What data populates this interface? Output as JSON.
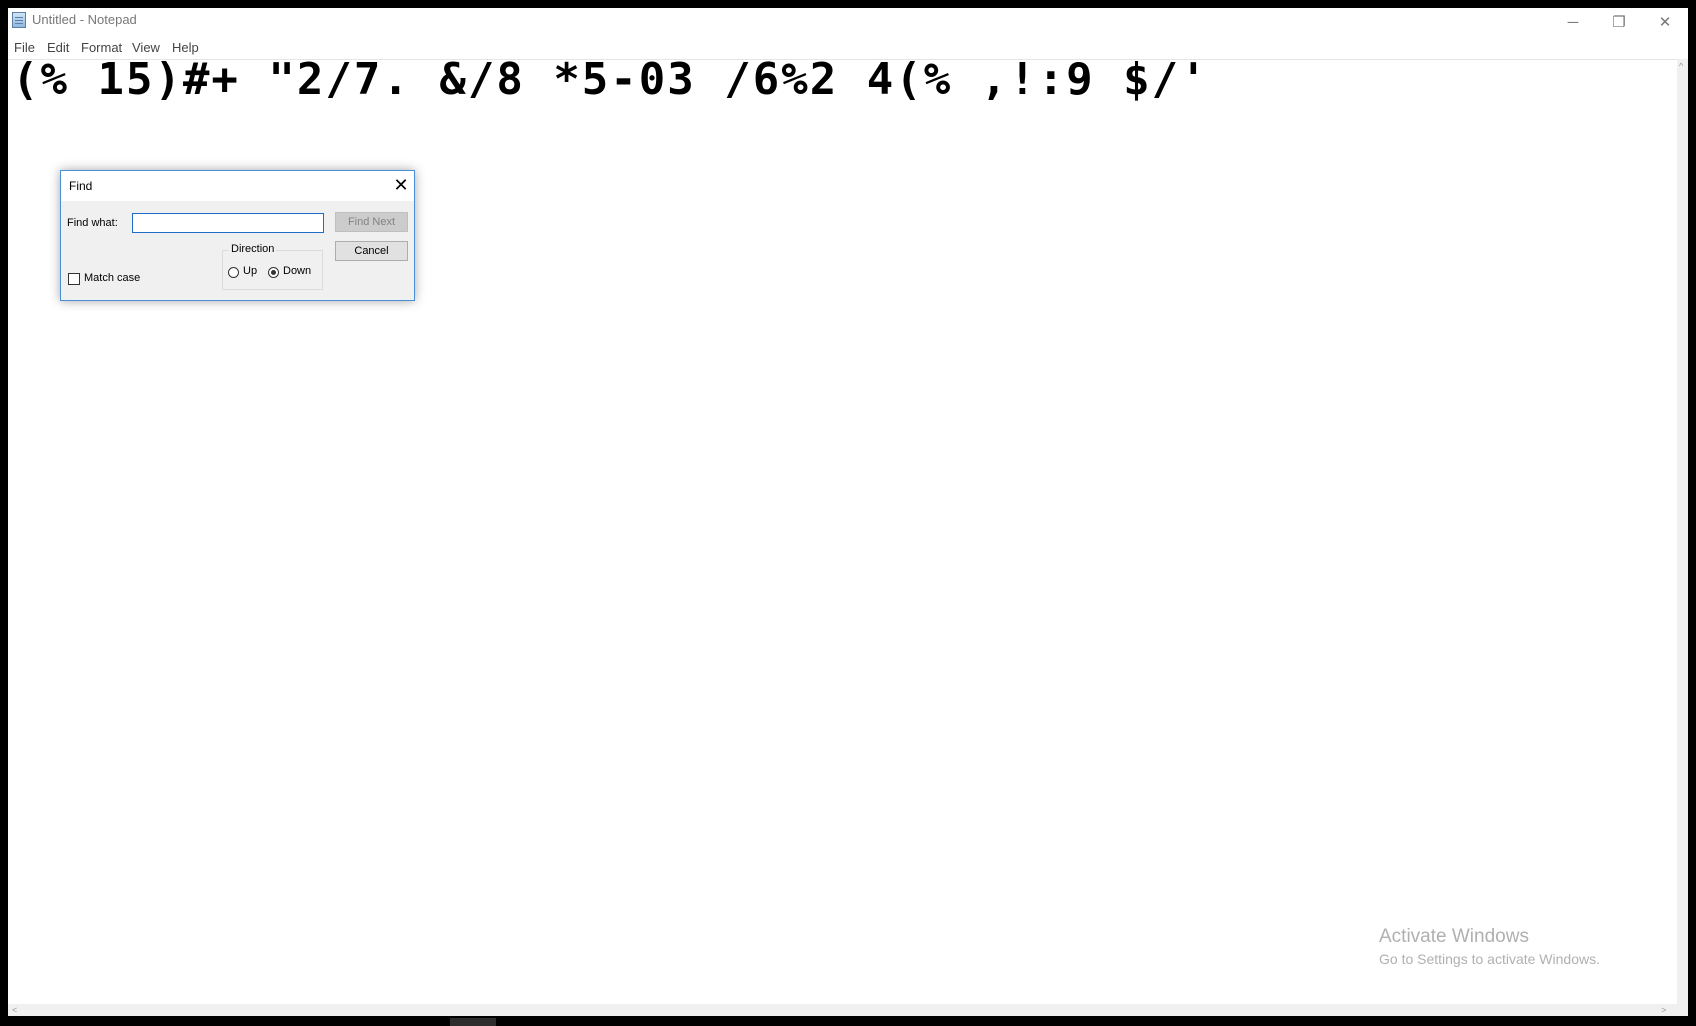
{
  "window": {
    "title": "Untitled - Notepad",
    "controls": {
      "minimize": "─",
      "restore": "❐",
      "close": "✕"
    }
  },
  "menu": {
    "items": [
      "File",
      "Edit",
      "Format",
      "View",
      "Help"
    ]
  },
  "editor": {
    "content": "(% 15)#+ \"2/7. &/8 *5-03 /6%2 4(% ,!:9 $/'"
  },
  "find_dialog": {
    "title": "Find",
    "close_glyph": "✕",
    "find_what_label": "Find what:",
    "find_what_value": "",
    "find_next_label": "Find Next",
    "find_next_enabled": false,
    "cancel_label": "Cancel",
    "direction_label": "Direction",
    "up_label": "Up",
    "down_label": "Down",
    "direction_selected": "Down",
    "match_case_label": "Match case",
    "match_case_checked": false
  },
  "watermark": {
    "line1": "Activate Windows",
    "line2": "Go to Settings to activate Windows."
  },
  "scrollbar": {
    "left_arrow": "<",
    "right_arrow": ">",
    "up_arrow": "^"
  }
}
